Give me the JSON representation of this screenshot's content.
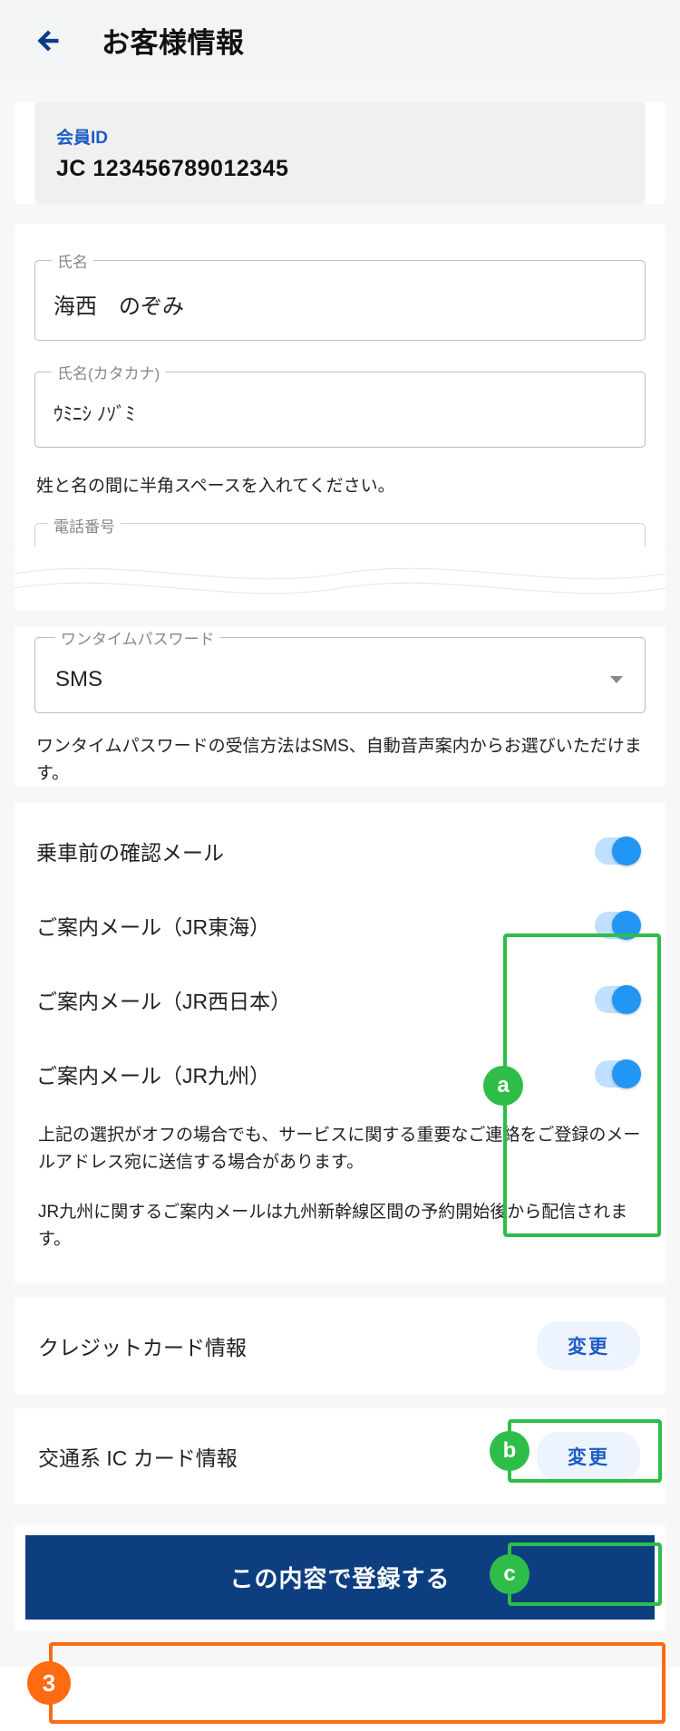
{
  "header": {
    "title": "お客様情報"
  },
  "member": {
    "label": "会員ID",
    "value": "JC 123456789012345"
  },
  "name": {
    "label": "氏名",
    "value": "海西　のぞみ"
  },
  "name_kana": {
    "label": "氏名(カタカナ)",
    "value": "ｳﾐﾆｼ ﾉｿﾞﾐ"
  },
  "name_helper": "姓と名の間に半角スペースを入れてください。",
  "phone": {
    "label": "電話番号"
  },
  "otp": {
    "label": "ワンタイムパスワード",
    "value": "SMS",
    "helper": "ワンタイムパスワードの受信方法はSMS、自動音声案内からお選びいただけます。"
  },
  "toggles": [
    {
      "label": "乗車前の確認メール",
      "on": true
    },
    {
      "label": "ご案内メール（JR東海）",
      "on": true
    },
    {
      "label": "ご案内メール（JR西日本）",
      "on": true
    },
    {
      "label": "ご案内メール（JR九州）",
      "on": true
    }
  ],
  "toggle_note1": "上記の選択がオフの場合でも、サービスに関する重要なご連絡をご登録のメールアドレス宛に送信する場合があります。",
  "toggle_note2": "JR九州に関するご案内メールは九州新幹線区間の予約開始後から配信されます。",
  "credit": {
    "label": "クレジットカード情報",
    "button": "変更"
  },
  "ic": {
    "label": "交通系 IC カード情報",
    "button": "変更"
  },
  "submit": "この内容で登録する",
  "annotations": {
    "a": "a",
    "b": "b",
    "c": "c",
    "n3": "3"
  }
}
